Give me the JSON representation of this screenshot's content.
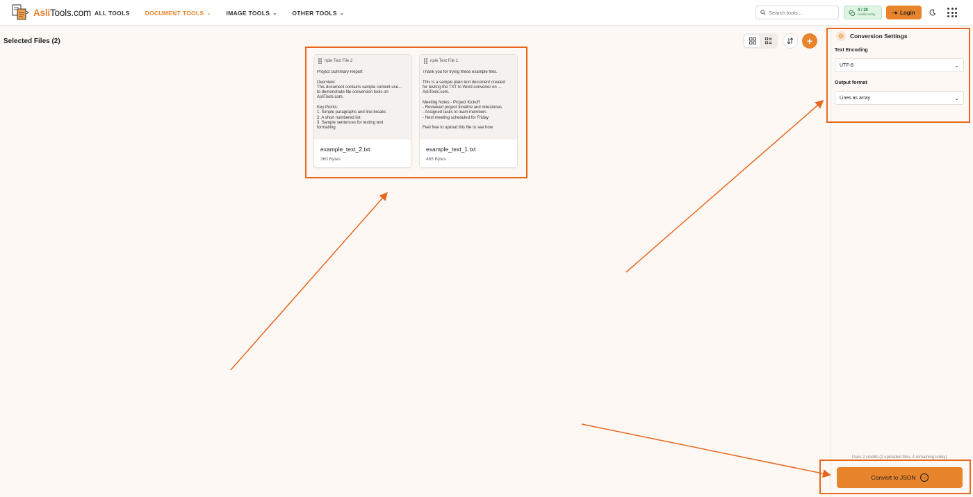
{
  "header": {
    "logo_brand": "Asli",
    "logo_rest": "Tools.com",
    "nav": [
      {
        "label": "ALL TOOLS",
        "active": false,
        "dropdown": false
      },
      {
        "label": "DOCUMENT TOOLS",
        "active": true,
        "dropdown": true
      },
      {
        "label": "IMAGE TOOLS",
        "active": false,
        "dropdown": true
      },
      {
        "label": "OTHER TOOLS",
        "active": false,
        "dropdown": true
      }
    ],
    "search_placeholder": "Search tools...",
    "credits_count": "4 / 20",
    "credits_label": "credits today",
    "login_label": "Login"
  },
  "main": {
    "selected_title": "Selected Files (2)",
    "files": [
      {
        "header": "nple Text File 2",
        "preview": "Project Summary Report\n\nOverview:\nThis document contains sample content use...\nto demonstrate file conversion tools on\nAsliTools.com.\n\nKey Points:\n1. Simple paragraphs and line breaks\n2. A short numbered list\n3. Sample sentences for testing text\nformatting",
        "name": "example_text_2.txt",
        "size": "360 Bytes"
      },
      {
        "header": "nple Text File 1",
        "preview": "Thank you for trying these example files.\n\nThis is a sample plain text document created\nfor testing the TXT to Word converter on ...\nAsliTools.com.\n\nMeeting Notes - Project Kickoff\n- Reviewed project timeline and milestones\n- Assigned tasks to team members\n- Next meeting scheduled for Friday\n\nFeel free to upload this file to see how",
        "name": "example_text_1.txt",
        "size": "465 Bytes"
      }
    ]
  },
  "sidebar": {
    "title": "Conversion Settings",
    "encoding_label": "Text Encoding",
    "encoding_value": "UTF-8",
    "output_label": "Output format",
    "output_value": "Lines as array",
    "credits_note": "Uses 2 credits (2 uploaded files, 4 remaining today)",
    "convert_label": "Convert to JSON"
  },
  "colors": {
    "accent": "#e8842b",
    "annotation": "#e8661e",
    "background": "#fdf8f3"
  }
}
